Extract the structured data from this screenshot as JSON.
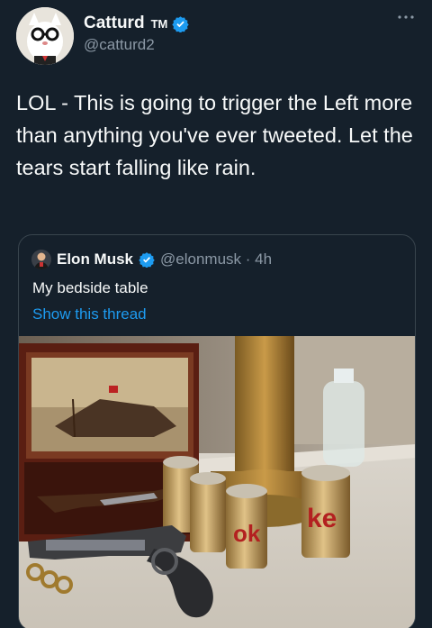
{
  "tweet": {
    "author_name": "Catturd",
    "author_tm": "TM",
    "author_handle": "@catturd2",
    "text": "LOL - This is going to trigger the Left more than anything you've ever tweeted. Let the tears start falling like rain."
  },
  "quote": {
    "author_name": "Elon Musk",
    "author_handle": "@elonmusk",
    "separator": "·",
    "time": "4h",
    "text": "My bedside table",
    "thread_link": "Show this thread"
  },
  "icons": {
    "verified": "verified-badge-icon",
    "more": "more-options-icon"
  },
  "colors": {
    "background": "#15202b",
    "link": "#1d9bf0",
    "muted": "#8b98a5",
    "verified": "#1d9bf0"
  },
  "photo": {
    "can_label_1": "ke",
    "can_label_2": "ok"
  }
}
